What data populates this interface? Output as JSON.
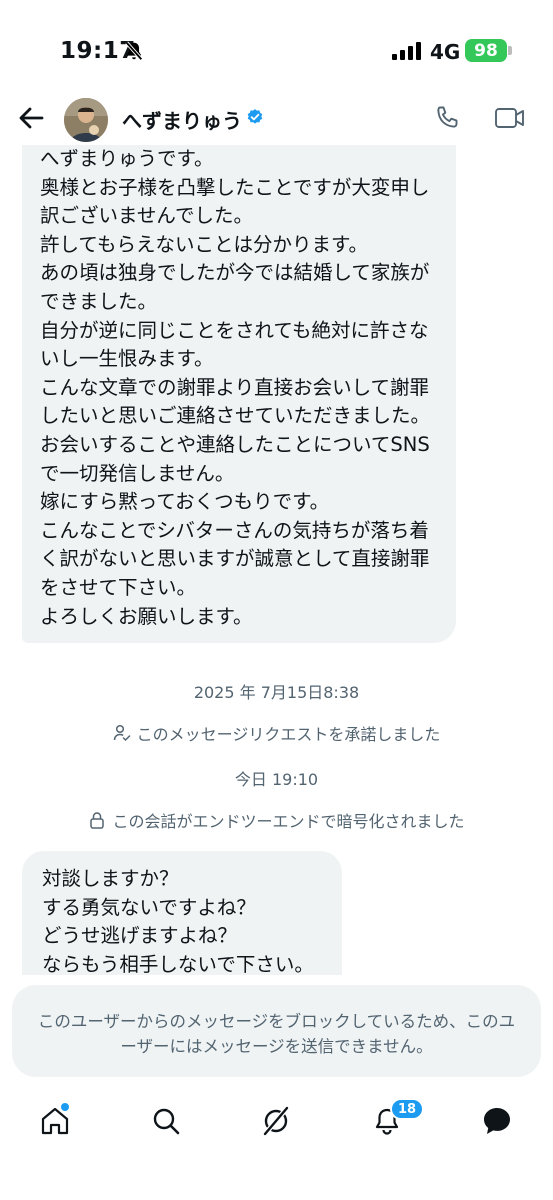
{
  "status_bar": {
    "time": "19:17",
    "network": "4G",
    "battery": "98",
    "battery_color": "#34c759"
  },
  "header": {
    "contact_name": "へずまりゅう",
    "verified_color": "#1d9bf0"
  },
  "messages": [
    {
      "text": "へずまりゅうです。\n奥様とお子様を凸撃したことですが大変申し訳ございませんでした。\n許してもらえないことは分かります。\nあの頃は独身でしたが今では結婚して家族ができました。\n自分が逆に同じことをされても絶対に許さないし一生恨みます。\nこんな文章での謝罪より直接お会いして謝罪したいと思いご連絡させていただきました。\nお会いすることや連絡したことについてSNSで一切発信しません。\n嫁にすら黙っておくつもりです。\nこんなことでシバターさんの気持ちが落ち着く訳がないと思いますが誠意として直接謝罪をさせて下さい。\nよろしくお願いします。"
    },
    {
      "text": "対談しますか？\nする勇気ないですよね？\nどうせ逃げますよね？\nならもう相手しないで下さい。"
    }
  ],
  "meta": {
    "timestamp_1": "2025 年 7月15日8:38",
    "request_accepted": "このメッセージリクエストを承諾しました",
    "timestamp_2": "今日 19:10",
    "encrypted": "この会話がエンドツーエンドで暗号化されました"
  },
  "blocked_notice": "このユーザーからのメッセージをブロックしているため、このユーザーにはメッセージを送信できません。",
  "bottom_nav": {
    "notification_count": "18",
    "accent_color": "#1d9bf0"
  },
  "icons": [
    "silent-bell-icon",
    "signal-icon",
    "back-arrow-icon",
    "verified-badge-icon",
    "phone-icon",
    "video-icon",
    "person-check-icon",
    "lock-icon",
    "home-icon",
    "search-icon",
    "grok-icon",
    "notification-bell-icon",
    "messages-icon"
  ]
}
